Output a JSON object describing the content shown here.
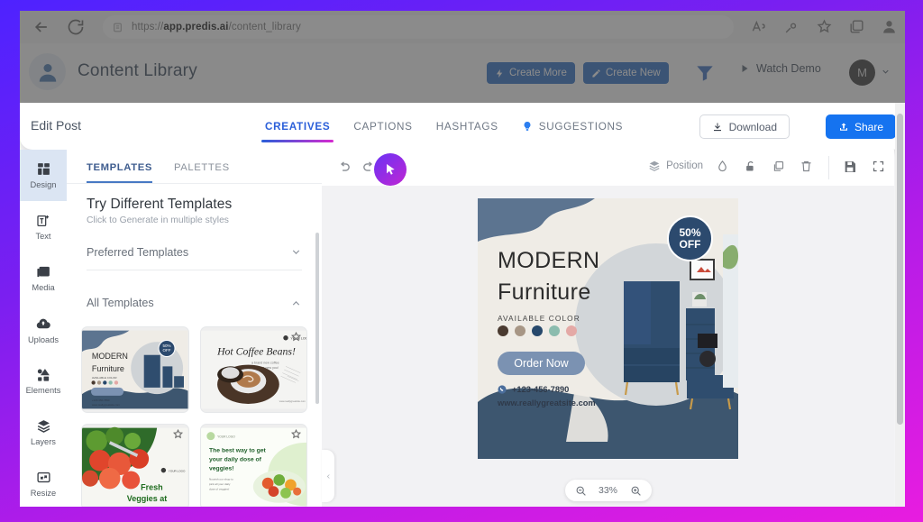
{
  "browser": {
    "url_prefix": "https://",
    "url_domain": "app.predis.ai",
    "url_path": "/content_library",
    "back_icon": "back-arrow-icon",
    "reload_icon": "reload-icon",
    "lock_icon": "site-info-icon",
    "right_icons": [
      "read-aloud-icon",
      "copilot-icon",
      "favorites-star-icon",
      "collections-icon",
      "browser-profile-icon"
    ]
  },
  "header": {
    "title": "Content Library",
    "avatar_icon": "user-avatar-icon",
    "create_more": "Create More",
    "create_more_icon": "lightning-icon",
    "create_new": "Create New",
    "create_new_icon": "pencil-icon",
    "filter_icon": "filter-icon",
    "watch_demo": "Watch Demo",
    "watch_demo_icon": "play-icon",
    "avatar_initial": "M",
    "caret_icon": "chevron-down-icon"
  },
  "editor": {
    "title": "Edit Post",
    "tabs": [
      {
        "label": "CREATIVES",
        "active": true
      },
      {
        "label": "CAPTIONS",
        "active": false
      },
      {
        "label": "HASHTAGS",
        "active": false
      },
      {
        "label": "SUGGESTIONS",
        "active": false,
        "icon": "lightbulb-icon"
      }
    ],
    "download": "Download",
    "download_icon": "download-icon",
    "share": "Share",
    "share_icon": "share-icon",
    "accent": "#2b5fd9",
    "share_color": "#1573f0"
  },
  "rail": [
    {
      "label": "Design",
      "icon": "grid-icon",
      "active": true
    },
    {
      "label": "Text",
      "icon": "text-add-icon",
      "active": false
    },
    {
      "label": "Media",
      "icon": "image-icon",
      "active": false
    },
    {
      "label": "Uploads",
      "icon": "upload-cloud-icon",
      "active": false
    },
    {
      "label": "Elements",
      "icon": "shapes-icon",
      "active": false
    },
    {
      "label": "Layers",
      "icon": "layers-icon",
      "active": false
    },
    {
      "label": "Resize",
      "icon": "resize-icon",
      "active": false
    }
  ],
  "panel": {
    "tabs": [
      {
        "label": "TEMPLATES",
        "active": true
      },
      {
        "label": "PALETTES",
        "active": false
      }
    ],
    "heading": "Try Different Templates",
    "subheading": "Click to Generate in multiple styles",
    "preferred_label": "Preferred Templates",
    "preferred_caret": "chevron-down-icon",
    "all_label": "All Templates",
    "all_caret": "chevron-up-icon",
    "thumbnails": [
      {
        "name": "modern-furniture-template",
        "title": "MODERN",
        "title2": "Furniture",
        "starred": false
      },
      {
        "name": "hot-coffee-template",
        "title": "Hot Coffee Beans!",
        "starred": true
      },
      {
        "name": "fresh-veggies-template",
        "title": "Fresh Veggies at",
        "starred": true
      },
      {
        "name": "daily-veggies-template",
        "title": "The best way to get your daily dose of veggies!",
        "starred": true
      }
    ]
  },
  "toolbar": {
    "undo_icon": "undo-icon",
    "redo_icon": "redo-icon",
    "position_label": "Position",
    "position_icon": "layers-stack-icon",
    "droplet_icon": "droplet-icon",
    "lock_icon": "unlock-icon",
    "duplicate_icon": "duplicate-icon",
    "delete_icon": "trash-icon",
    "save_icon": "save-icon",
    "fullscreen_icon": "fullscreen-icon"
  },
  "design": {
    "headline1": "MODERN",
    "headline2": "Furniture",
    "available_color_label": "AVAILABLE COLOR",
    "swatches": [
      "#4a3a30",
      "#a79685",
      "#26486b",
      "#8bbcae",
      "#e4a9a6"
    ],
    "cta": "Order Now",
    "phone": "+123-456-7890",
    "phone_icon": "phone-icon",
    "website": "www.reallygreatsite.com",
    "badge_line1": "50%",
    "badge_line2": "OFF",
    "badge_color": "#2c4a6e",
    "wave_color": "#5c7490",
    "cta_color": "#7b92b2"
  },
  "zoom": {
    "level": "33%",
    "out_icon": "zoom-out-icon",
    "in_icon": "zoom-in-icon"
  },
  "cursor": {
    "icon": "mouse-pointer-icon"
  }
}
